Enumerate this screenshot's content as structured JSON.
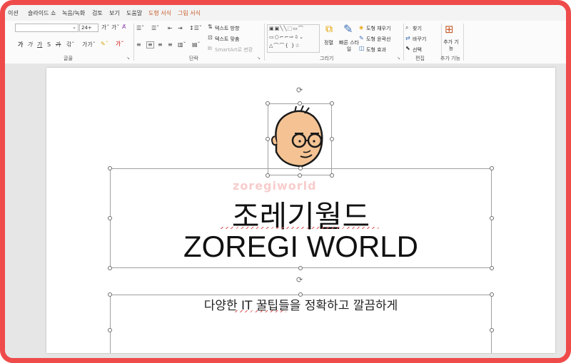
{
  "tabs": [
    {
      "label": "이션",
      "context": false
    },
    {
      "label": "슬라이드 쇼",
      "context": false
    },
    {
      "label": "녹음/녹화",
      "context": false
    },
    {
      "label": "검토",
      "context": false
    },
    {
      "label": "보기",
      "context": false
    },
    {
      "label": "도움말",
      "context": false
    },
    {
      "label": "도형 서식",
      "context": true
    },
    {
      "label": "그림 서식",
      "context": true
    }
  ],
  "ribbon": {
    "font": {
      "size": "24+",
      "group_label": "글꼴"
    },
    "paragraph": {
      "text_direction": "텍스트 방향",
      "align_text": "텍스트 맞춤",
      "smartart": "SmartArt로 변환",
      "group_label": "단락"
    },
    "drawing": {
      "arrange": "정렬",
      "quick_styles": "빠른 스타일",
      "fill": "도형 채우기",
      "outline": "도형 윤곽선",
      "effects": "도형 효과",
      "group_label": "그리기"
    },
    "editing": {
      "find": "찾기",
      "replace": "바꾸기",
      "select": "선택",
      "group_label": "편집"
    },
    "addins": {
      "label": "추가 기능",
      "group_label": "추가 기능"
    }
  },
  "slide": {
    "watermark": "zoregiworld",
    "title_line1": "조레기월드",
    "title_line2": "ZOREGI WORLD",
    "subtitle": "다양한 IT 꿀팁들을 정확하고 깔끔하게"
  },
  "colors": {
    "frame": "#ef4b4b",
    "context_tab": "#c65b2a",
    "face": "#f5c393"
  }
}
